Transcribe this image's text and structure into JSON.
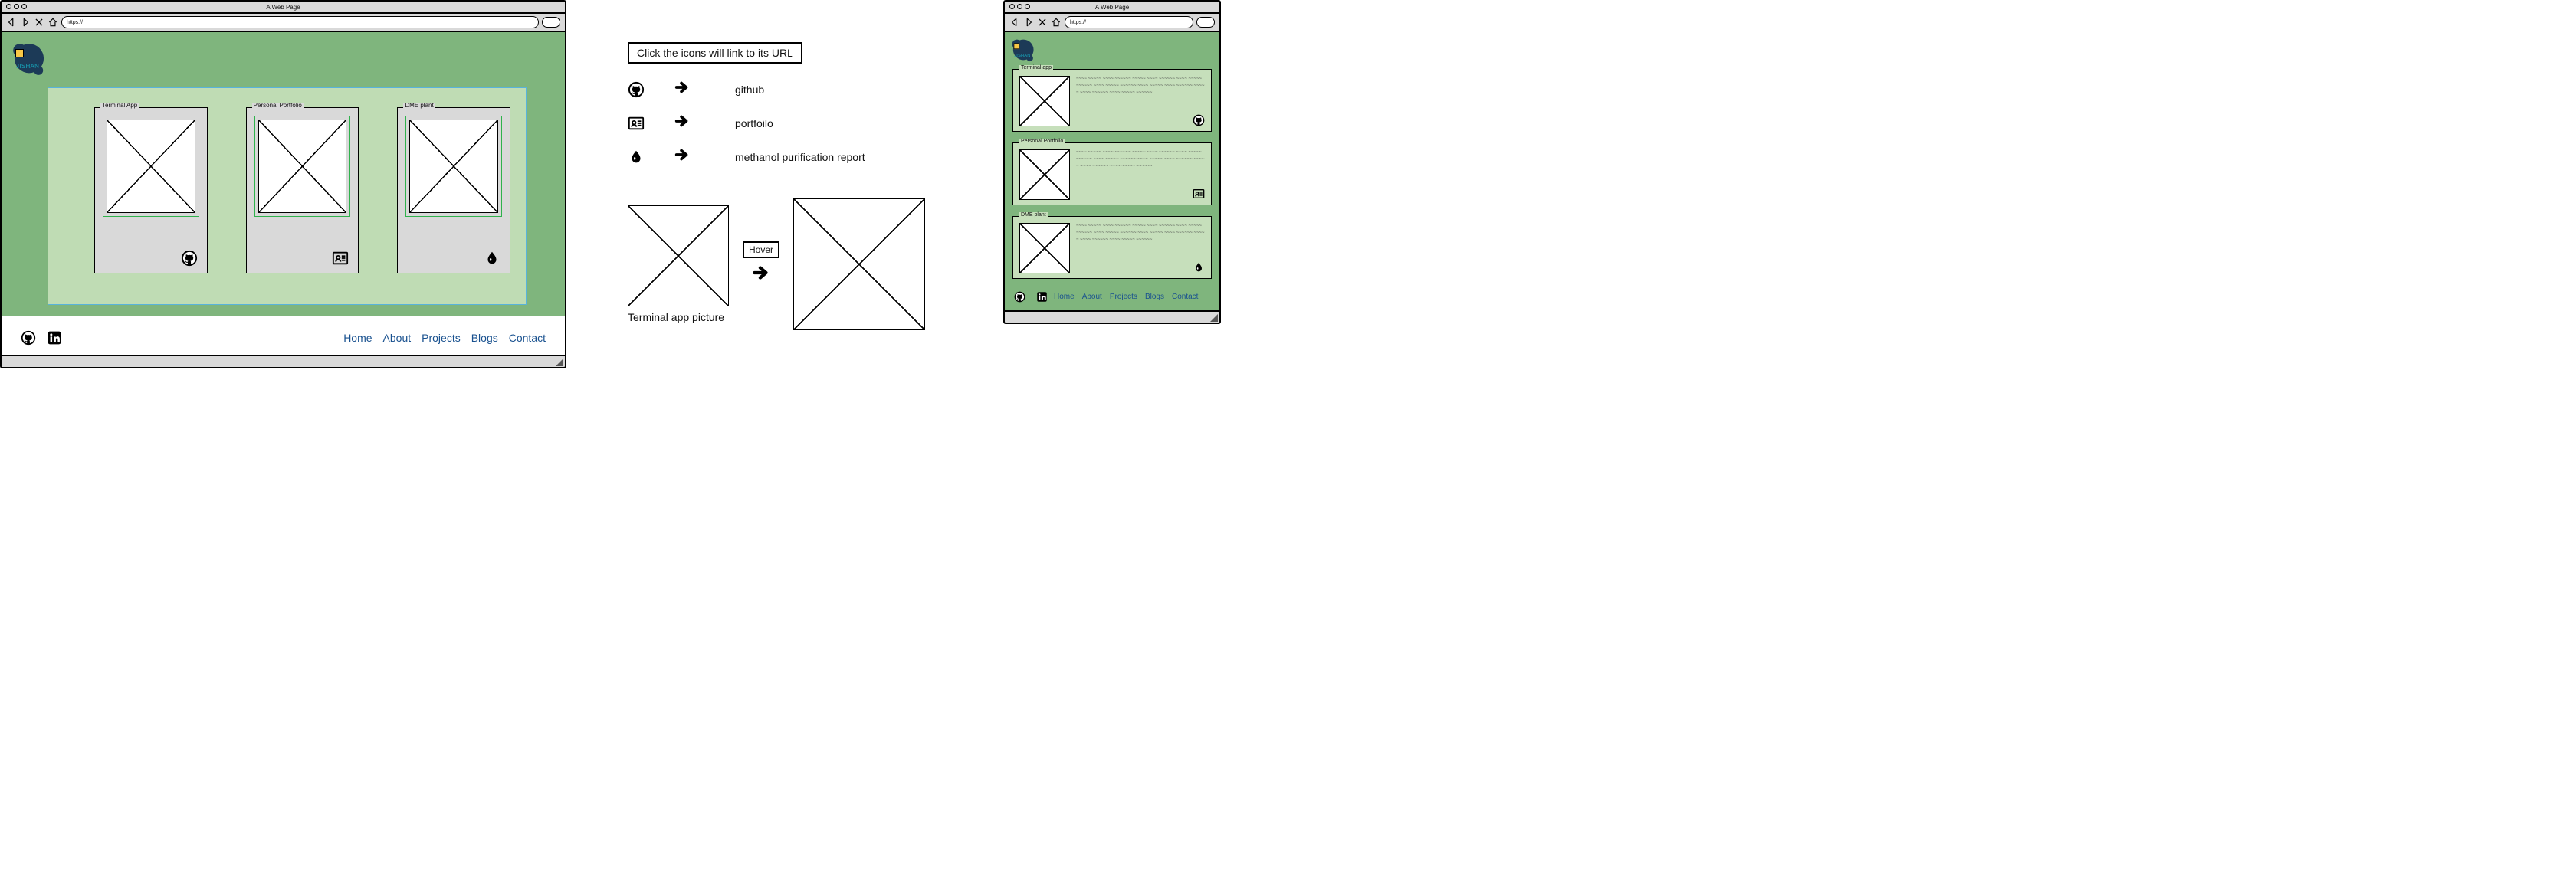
{
  "chrome": {
    "title": "A Web Page",
    "url_prefix": "https://"
  },
  "logo": {
    "text": "JISHAN"
  },
  "projects": [
    {
      "title": "Terminal App",
      "icon": "github"
    },
    {
      "title": "Personal Portfolio",
      "icon": "portfolio"
    },
    {
      "title": "DME plant",
      "icon": "droplet"
    }
  ],
  "footer": {
    "social": [
      "github",
      "linkedin"
    ],
    "links": [
      "Home",
      "About",
      "Projects",
      "Blogs",
      "Contact"
    ]
  },
  "spec": {
    "note": "Click the icons will link to its URL",
    "map": [
      {
        "icon": "github",
        "dest": "github"
      },
      {
        "icon": "portfolio",
        "dest": "portfoilo"
      },
      {
        "icon": "droplet",
        "dest": "methanol purification report"
      }
    ],
    "hover_label": "Hover",
    "hover_caption": "Terminal app  picture"
  },
  "mobile": {
    "cards": [
      {
        "title": "Terminal app",
        "icon": "github"
      },
      {
        "title": "Personal Portfolio",
        "icon": "portfolio"
      },
      {
        "title": "DME plant",
        "icon": "droplet"
      }
    ],
    "lorem": "~~~~ ~~~~~ ~~~~ ~~~~~~ ~~~~~ ~~~~ ~~~~~~ ~~~~ ~~~~~ ~~~~~~ ~~~~ ~~~~~ ~~~~~~ ~~~~ ~~~~~ ~~~~ ~~~~~~ ~~~~~ ~~~~ ~~~~~~ ~~~~ ~~~~~ ~~~~~~"
  }
}
